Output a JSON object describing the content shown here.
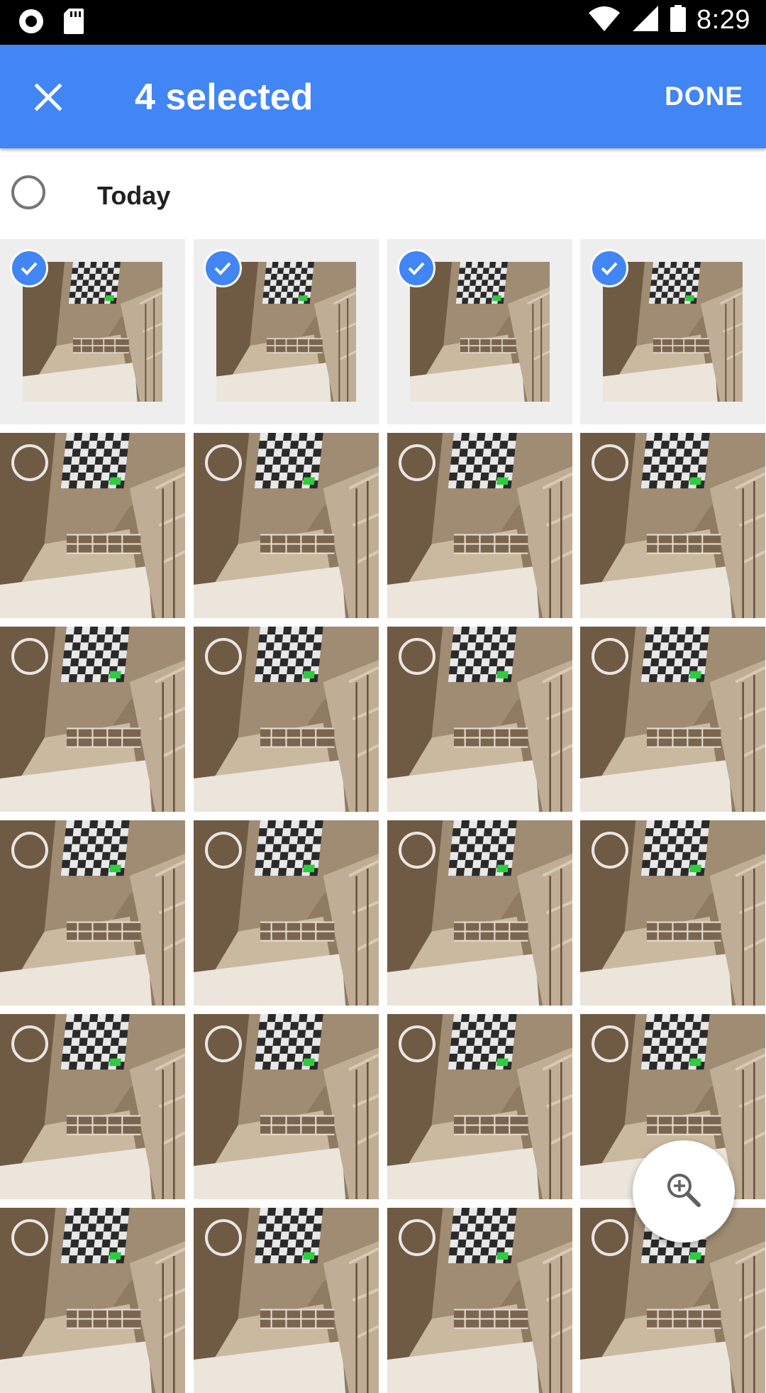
{
  "status_bar": {
    "time": "8:29",
    "icons": [
      "record-icon",
      "sd-card-icon",
      "wifi-icon",
      "signal-icon",
      "battery-icon"
    ]
  },
  "app_bar": {
    "close_icon": "close-icon",
    "title": "4 selected",
    "done_label": "DONE",
    "color": "#4285f4"
  },
  "section": {
    "label": "Today"
  },
  "photos": [
    {
      "selected": true
    },
    {
      "selected": true
    },
    {
      "selected": true
    },
    {
      "selected": true
    },
    {
      "selected": false
    },
    {
      "selected": false
    },
    {
      "selected": false
    },
    {
      "selected": false
    },
    {
      "selected": false
    },
    {
      "selected": false
    },
    {
      "selected": false
    },
    {
      "selected": false
    },
    {
      "selected": false
    },
    {
      "selected": false
    },
    {
      "selected": false
    },
    {
      "selected": false
    },
    {
      "selected": false
    },
    {
      "selected": false
    },
    {
      "selected": false
    },
    {
      "selected": false
    },
    {
      "selected": false
    },
    {
      "selected": false
    },
    {
      "selected": false
    },
    {
      "selected": false
    }
  ],
  "fab": {
    "icon": "zoom-in-icon"
  }
}
